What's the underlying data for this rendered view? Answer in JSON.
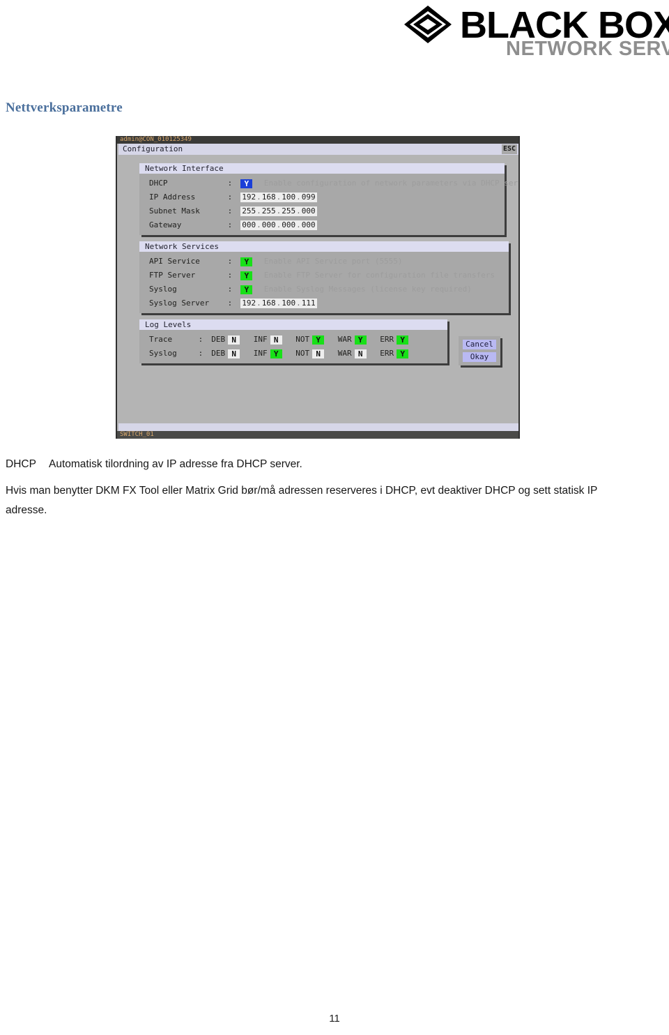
{
  "brand": {
    "name": "BLACK BOX",
    "registered_mark": "®",
    "tagline": "NETWORK SERVICES",
    "logo_icon": "diamond-logo-icon"
  },
  "heading": "Nettverksparametre",
  "terminal": {
    "title_bar": "admin@CON_010125349",
    "menu_label": "Configuration",
    "esc_label": "ESC",
    "status_bar": "SWITCH_01",
    "groups": [
      {
        "title": "Network Interface",
        "rows": [
          {
            "label": "DHCP",
            "colon": ":",
            "value": "Y",
            "value_style": "blue",
            "help": "Enable configuration of network parameters via DHCP server"
          },
          {
            "label": "IP Address",
            "colon": ":",
            "octets": [
              "192",
              "168",
              "100",
              "099"
            ]
          },
          {
            "label": "Subnet Mask",
            "colon": ":",
            "octets": [
              "255",
              "255",
              "255",
              "000"
            ]
          },
          {
            "label": "Gateway",
            "colon": ":",
            "octets": [
              "000",
              "000",
              "000",
              "000"
            ]
          }
        ]
      },
      {
        "title": "Network Services",
        "rows": [
          {
            "label": "API Service",
            "colon": ":",
            "value": "Y",
            "value_style": "green",
            "help": "Enable API Service port (5555)"
          },
          {
            "label": "FTP Server",
            "colon": ":",
            "value": "Y",
            "value_style": "green",
            "help": "Enable FTP Server for configuration file transfers"
          },
          {
            "label": "Syslog",
            "colon": ":",
            "value": "Y",
            "value_style": "green",
            "help": "Enable Syslog Messages (license key required)"
          },
          {
            "label": "Syslog Server",
            "colon": ":",
            "octets": [
              "192",
              "168",
              "100",
              "111"
            ]
          }
        ]
      },
      {
        "title": "Log Levels",
        "log_rows": [
          {
            "label": "Trace",
            "colon": ":",
            "cells": [
              {
                "name": "DEB",
                "value": "N",
                "value_style": "grey"
              },
              {
                "name": "INF",
                "value": "N",
                "value_style": "grey"
              },
              {
                "name": "NOT",
                "value": "Y",
                "value_style": "green"
              },
              {
                "name": "WAR",
                "value": "Y",
                "value_style": "green"
              },
              {
                "name": "ERR",
                "value": "Y",
                "value_style": "green"
              }
            ]
          },
          {
            "label": "Syslog",
            "colon": ":",
            "cells": [
              {
                "name": "DEB",
                "value": "N",
                "value_style": "grey"
              },
              {
                "name": "INF",
                "value": "Y",
                "value_style": "green"
              },
              {
                "name": "NOT",
                "value": "N",
                "value_style": "grey"
              },
              {
                "name": "WAR",
                "value": "N",
                "value_style": "grey"
              },
              {
                "name": "ERR",
                "value": "Y",
                "value_style": "green"
              }
            ]
          }
        ]
      }
    ],
    "buttons": [
      {
        "label": "Cancel"
      },
      {
        "label": "Okay"
      }
    ]
  },
  "body": {
    "definition_term": "DHCP",
    "definition_text": "Automatisk tilordning av IP adresse fra DHCP server.",
    "paragraph": "Hvis man benytter DKM FX Tool eller Matrix Grid bør/må adressen reserveres i DHCP, evt deaktiver DHCP og sett statisk IP adresse."
  },
  "page_number": "11",
  "colors": {
    "heading": "#4a6f9c",
    "terminal_bg": "#b4b4b4",
    "group_bg": "#a8a8a8",
    "group_title_bg": "#dcdcf0",
    "value_on": "#18e018",
    "value_selected": "#1b3fd8",
    "value_off": "#eeeeee",
    "button_bg": "#b9b9f2",
    "titlebar_bg": "#3a3a38",
    "titlebar_text": "#d9a86c",
    "brand_grey": "#8e8e8e"
  }
}
